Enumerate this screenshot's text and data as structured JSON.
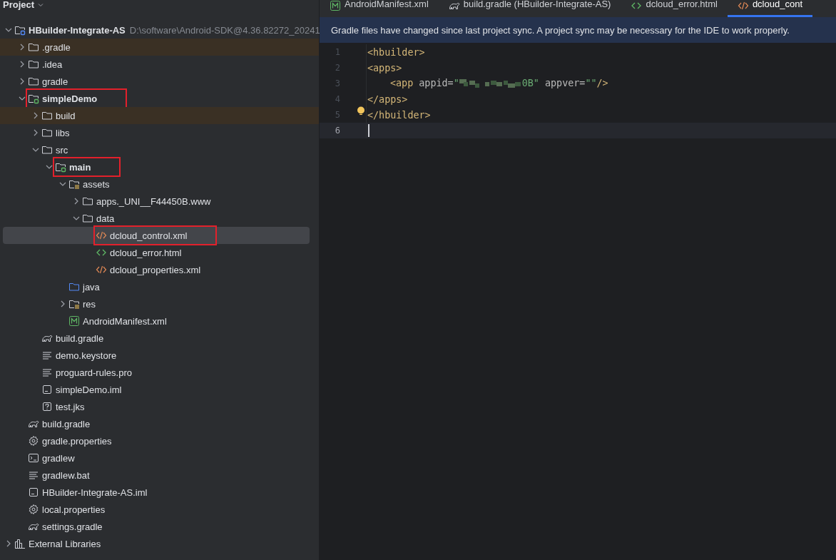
{
  "project_panel": {
    "title": "Project",
    "tree": [
      {
        "label": "HBuilder-Integrate-AS",
        "path": "D:\\software\\Android-SDK@4.36.82272_20241",
        "kind": "project-module",
        "bold": true,
        "expanded": true,
        "selected": false,
        "excluded": false,
        "marked": false,
        "children": [
          {
            "label": ".gradle",
            "kind": "folder",
            "bold": false,
            "expanded": false,
            "selected": false,
            "excluded": true,
            "marked": false
          },
          {
            "label": ".idea",
            "kind": "folder",
            "bold": false,
            "expanded": false,
            "selected": false,
            "excluded": false,
            "marked": false
          },
          {
            "label": "gradle",
            "kind": "folder",
            "bold": false,
            "expanded": false,
            "selected": false,
            "excluded": false,
            "marked": false
          },
          {
            "label": "simpleDemo",
            "kind": "module",
            "bold": true,
            "expanded": true,
            "selected": false,
            "excluded": false,
            "marked": true,
            "children": [
              {
                "label": "build",
                "kind": "folder",
                "bold": false,
                "expanded": false,
                "selected": false,
                "excluded": true,
                "marked": false
              },
              {
                "label": "libs",
                "kind": "folder",
                "bold": false,
                "expanded": false,
                "selected": false,
                "excluded": false,
                "marked": false
              },
              {
                "label": "src",
                "kind": "folder",
                "bold": false,
                "expanded": true,
                "selected": false,
                "excluded": false,
                "marked": false,
                "children": [
                  {
                    "label": "main",
                    "kind": "module",
                    "bold": true,
                    "expanded": true,
                    "selected": false,
                    "excluded": false,
                    "marked": true,
                    "children": [
                      {
                        "label": "assets",
                        "kind": "resources",
                        "bold": false,
                        "expanded": true,
                        "selected": false,
                        "excluded": false,
                        "marked": false,
                        "children": [
                          {
                            "label": "apps._UNI__F44450B.www",
                            "kind": "folder",
                            "bold": false,
                            "expanded": false,
                            "selected": false,
                            "excluded": false,
                            "marked": false
                          },
                          {
                            "label": "data",
                            "kind": "folder",
                            "bold": false,
                            "expanded": true,
                            "selected": false,
                            "excluded": false,
                            "marked": false,
                            "children": [
                              {
                                "label": "dcloud_control.xml",
                                "kind": "xml",
                                "bold": false,
                                "selected": true,
                                "excluded": false,
                                "marked": true
                              },
                              {
                                "label": "dcloud_error.html",
                                "kind": "html",
                                "bold": false,
                                "selected": false,
                                "excluded": false,
                                "marked": false
                              },
                              {
                                "label": "dcloud_properties.xml",
                                "kind": "xml",
                                "bold": false,
                                "selected": false,
                                "excluded": false,
                                "marked": false
                              }
                            ]
                          }
                        ]
                      },
                      {
                        "label": "java",
                        "kind": "source",
                        "bold": false,
                        "selected": false,
                        "excluded": false,
                        "marked": false
                      },
                      {
                        "label": "res",
                        "kind": "resources",
                        "bold": false,
                        "expanded": false,
                        "selected": false,
                        "excluded": false,
                        "marked": false
                      },
                      {
                        "label": "AndroidManifest.xml",
                        "kind": "manifest",
                        "bold": false,
                        "selected": false,
                        "excluded": false,
                        "marked": false
                      }
                    ]
                  }
                ]
              },
              {
                "label": "build.gradle",
                "kind": "gradle",
                "bold": false,
                "selected": false,
                "excluded": false,
                "marked": false
              },
              {
                "label": "demo.keystore",
                "kind": "text",
                "bold": false,
                "selected": false,
                "excluded": false,
                "marked": false
              },
              {
                "label": "proguard-rules.pro",
                "kind": "text",
                "bold": false,
                "selected": false,
                "excluded": false,
                "marked": false
              },
              {
                "label": "simpleDemo.iml",
                "kind": "iml",
                "bold": false,
                "selected": false,
                "excluded": false,
                "marked": false
              },
              {
                "label": "test.jks",
                "kind": "unknown",
                "bold": false,
                "selected": false,
                "excluded": false,
                "marked": false
              }
            ]
          },
          {
            "label": "build.gradle",
            "kind": "gradle",
            "bold": false,
            "selected": false,
            "excluded": false,
            "marked": false
          },
          {
            "label": "gradle.properties",
            "kind": "properties",
            "bold": false,
            "selected": false,
            "excluded": false,
            "marked": false
          },
          {
            "label": "gradlew",
            "kind": "shell",
            "bold": false,
            "selected": false,
            "excluded": false,
            "marked": false
          },
          {
            "label": "gradlew.bat",
            "kind": "text",
            "bold": false,
            "selected": false,
            "excluded": false,
            "marked": false
          },
          {
            "label": "HBuilder-Integrate-AS.iml",
            "kind": "iml",
            "bold": false,
            "selected": false,
            "excluded": false,
            "marked": false
          },
          {
            "label": "local.properties",
            "kind": "properties",
            "bold": false,
            "selected": false,
            "excluded": false,
            "marked": false
          },
          {
            "label": "settings.gradle",
            "kind": "gradle",
            "bold": false,
            "selected": false,
            "excluded": false,
            "marked": false
          }
        ]
      },
      {
        "label": "External Libraries",
        "kind": "libraries",
        "bold": false,
        "expanded": false,
        "selected": false,
        "excluded": false,
        "marked": false
      }
    ]
  },
  "editor": {
    "tabs": [
      {
        "label": "AndroidManifest.xml",
        "kind": "manifest",
        "selected": false
      },
      {
        "label": "build.gradle (HBuilder-Integrate-AS)",
        "kind": "gradle",
        "selected": false
      },
      {
        "label": "dcloud_error.html",
        "kind": "html",
        "selected": false
      },
      {
        "label": "dcloud_cont",
        "kind": "xml",
        "selected": true
      }
    ],
    "notification": "Gradle files have changed since last project sync. A project sync may be necessary for the IDE to work properly.",
    "lines": [
      {
        "number": "1",
        "indented": false,
        "current": false,
        "tokens": [
          {
            "kind": "tag",
            "text": "<hbuilder>"
          }
        ]
      },
      {
        "number": "2",
        "indented": false,
        "current": false,
        "tokens": [
          {
            "kind": "tag",
            "text": "<apps>"
          }
        ]
      },
      {
        "number": "3",
        "indented": true,
        "current": false,
        "tokens": [
          {
            "kind": "tag",
            "text": "<app "
          },
          {
            "kind": "attr",
            "text": "appid="
          },
          {
            "kind": "value",
            "text": "\""
          },
          {
            "kind": "redacted"
          },
          {
            "kind": "value",
            "text": "0B\""
          },
          {
            "kind": "attr",
            "text": " appver="
          },
          {
            "kind": "value",
            "text": "\"\""
          },
          {
            "kind": "tag",
            "text": "/>"
          }
        ]
      },
      {
        "number": "4",
        "indented": false,
        "current": false,
        "tokens": [
          {
            "kind": "tag",
            "text": "</apps>"
          }
        ]
      },
      {
        "number": "5",
        "indented": false,
        "current": false,
        "bulb": true,
        "tokens": [
          {
            "kind": "tag",
            "text": "</hbuilder>"
          }
        ]
      },
      {
        "number": "6",
        "indented": false,
        "current": true
      }
    ]
  }
}
